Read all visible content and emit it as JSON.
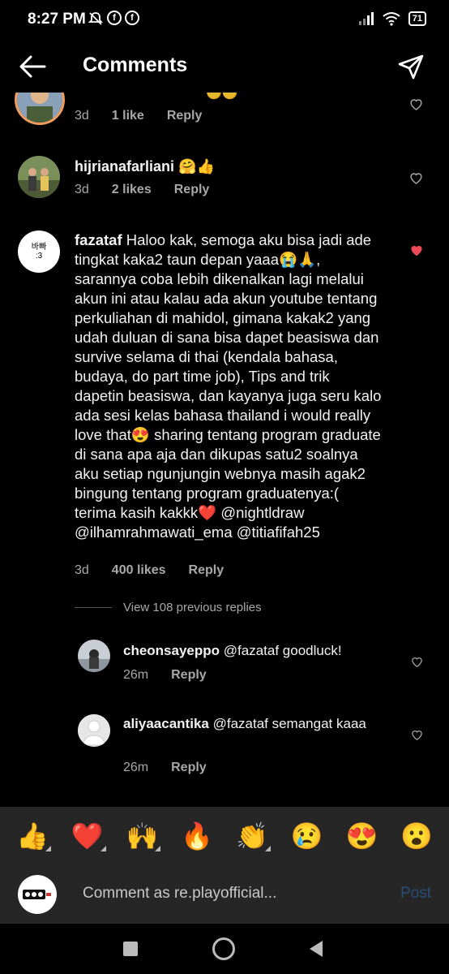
{
  "status_bar": {
    "time": "8:27 PM",
    "battery": "71"
  },
  "header": {
    "title": "Comments"
  },
  "comments": [
    {
      "likes": "1 like",
      "time": "3d",
      "reply": "Reply"
    },
    {
      "username": "hijrianafarliani",
      "text": "🤗👍",
      "time": "3d",
      "likes": "2 likes",
      "reply": "Reply"
    },
    {
      "username": "fazataf",
      "text": "Haloo kak, semoga aku bisa jadi ade tingkat kaka2 taun depan yaaa😭🙏, sarannya coba lebih dikenalkan lagi melalui akun ini atau kalau ada akun youtube tentang perkuliahan di mahidol, gimana kakak2 yang udah duluan di sana bisa dapet beasiswa dan survive selama di thai (kendala bahasa, budaya, do part time job), Tips and trik dapetin beasiswa, dan kayanya juga seru kalo ada sesi kelas bahasa thailand i would really love that😍 sharing tentang program graduate di sana apa aja dan dikupas satu2 soalnya aku setiap ngunjungin webnya masih agak2 bingung tentang program graduatenya:( terima kasih kakkk❤️ @nightldraw @ilhamrahmawati_ema @titiafifah25",
      "avatar_text": "바빠\n:3",
      "time": "3d",
      "likes": "400 likes",
      "reply": "Reply",
      "liked": true
    }
  ],
  "view_replies": "View 108 previous replies",
  "replies": [
    {
      "username": "cheonsayeppo",
      "text": "@fazataf goodluck!",
      "time": "26m",
      "reply": "Reply"
    },
    {
      "username": "aliyaacantika",
      "text": "@fazataf semangat kaaa",
      "time": "26m",
      "reply": "Reply"
    }
  ],
  "emoji_bar": [
    "👍",
    "❤️",
    "🙌",
    "🔥",
    "👏",
    "😢",
    "😍",
    "😮"
  ],
  "input": {
    "placeholder": "Comment as re.playofficial...",
    "post": "Post"
  },
  "colors": {
    "background": "#000000",
    "bar": "#262626",
    "heart_liked": "#ed4956",
    "post_disabled": "#2a4d78"
  }
}
